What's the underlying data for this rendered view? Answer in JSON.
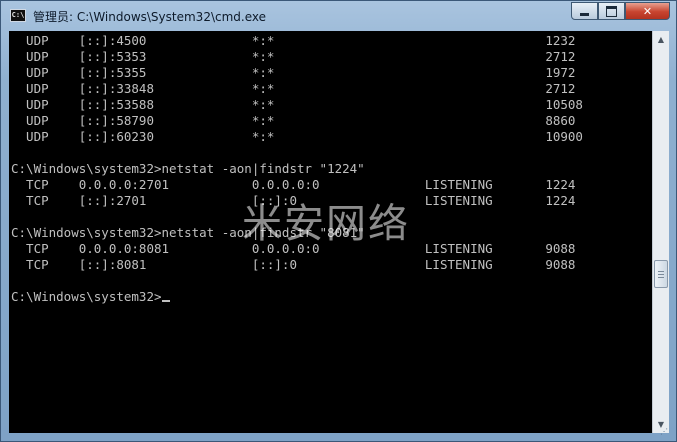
{
  "window": {
    "title": "管理员: C:\\Windows\\System32\\cmd.exe",
    "icon": "cmd-icon",
    "icon_text": "C:\\",
    "buttons": {
      "minimize": "minimize-icon",
      "maximize": "maximize-icon",
      "close": "✕"
    }
  },
  "console": {
    "lines": [
      "  UDP    [::]:4500              *:*                                    1232",
      "  UDP    [::]:5353              *:*                                    2712",
      "  UDP    [::]:5355              *:*                                    1972",
      "  UDP    [::]:33848             *:*                                    2712",
      "  UDP    [::]:53588             *:*                                    10508",
      "  UDP    [::]:58790             *:*                                    8860",
      "  UDP    [::]:60230             *:*                                    10900",
      "",
      "C:\\Windows\\system32>netstat -aon|findstr \"1224\"",
      "  TCP    0.0.0.0:2701           0.0.0.0:0              LISTENING       1224",
      "  TCP    [::]:2701              [::]:0                 LISTENING       1224",
      "",
      "C:\\Windows\\system32>netstat -aon|findstr \"8081\"",
      "  TCP    0.0.0.0:8081           0.0.0.0:0              LISTENING       9088",
      "  TCP    [::]:8081              [::]:0                 LISTENING       9088",
      "",
      "C:\\Windows\\system32>"
    ],
    "colors": {
      "background": "#000000",
      "text": "#c0c0c0"
    }
  },
  "watermark": {
    "text": "米安网络"
  },
  "scrollbar": {
    "up_arrow": "▲",
    "down_arrow": "▼"
  }
}
